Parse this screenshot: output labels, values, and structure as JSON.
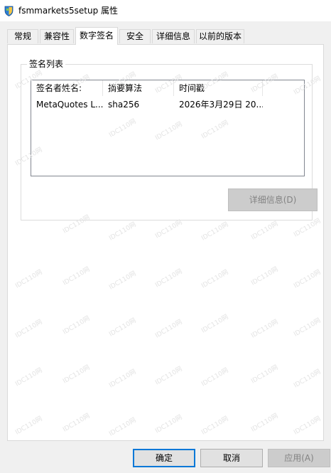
{
  "window": {
    "title": "fsmmarkets5setup 属性"
  },
  "tabs": [
    {
      "label": "常规",
      "active": false
    },
    {
      "label": "兼容性",
      "active": false
    },
    {
      "label": "数字签名",
      "active": true
    },
    {
      "label": "安全",
      "active": false
    },
    {
      "label": "详细信息",
      "active": false
    },
    {
      "label": "以前的版本",
      "active": false
    }
  ],
  "signature_list": {
    "group_label": "签名列表",
    "columns": [
      "签名者姓名:",
      "摘要算法",
      "时间戳"
    ],
    "rows": [
      {
        "signer": "MetaQuotes L...",
        "digest": "sha256",
        "timestamp": "2026年3月29日 20..."
      }
    ]
  },
  "details_button": {
    "label": "详细信息(D)",
    "enabled": false
  },
  "footer": {
    "ok_label": "确定",
    "cancel_label": "取消",
    "apply_label": "应用(A)"
  },
  "watermark_text": "IDC110网",
  "icons": {
    "app": "installer-shield-icon"
  },
  "colors": {
    "focus_border": "#0078d7",
    "disabled_text": "#838383",
    "listview_border": "#828790"
  }
}
